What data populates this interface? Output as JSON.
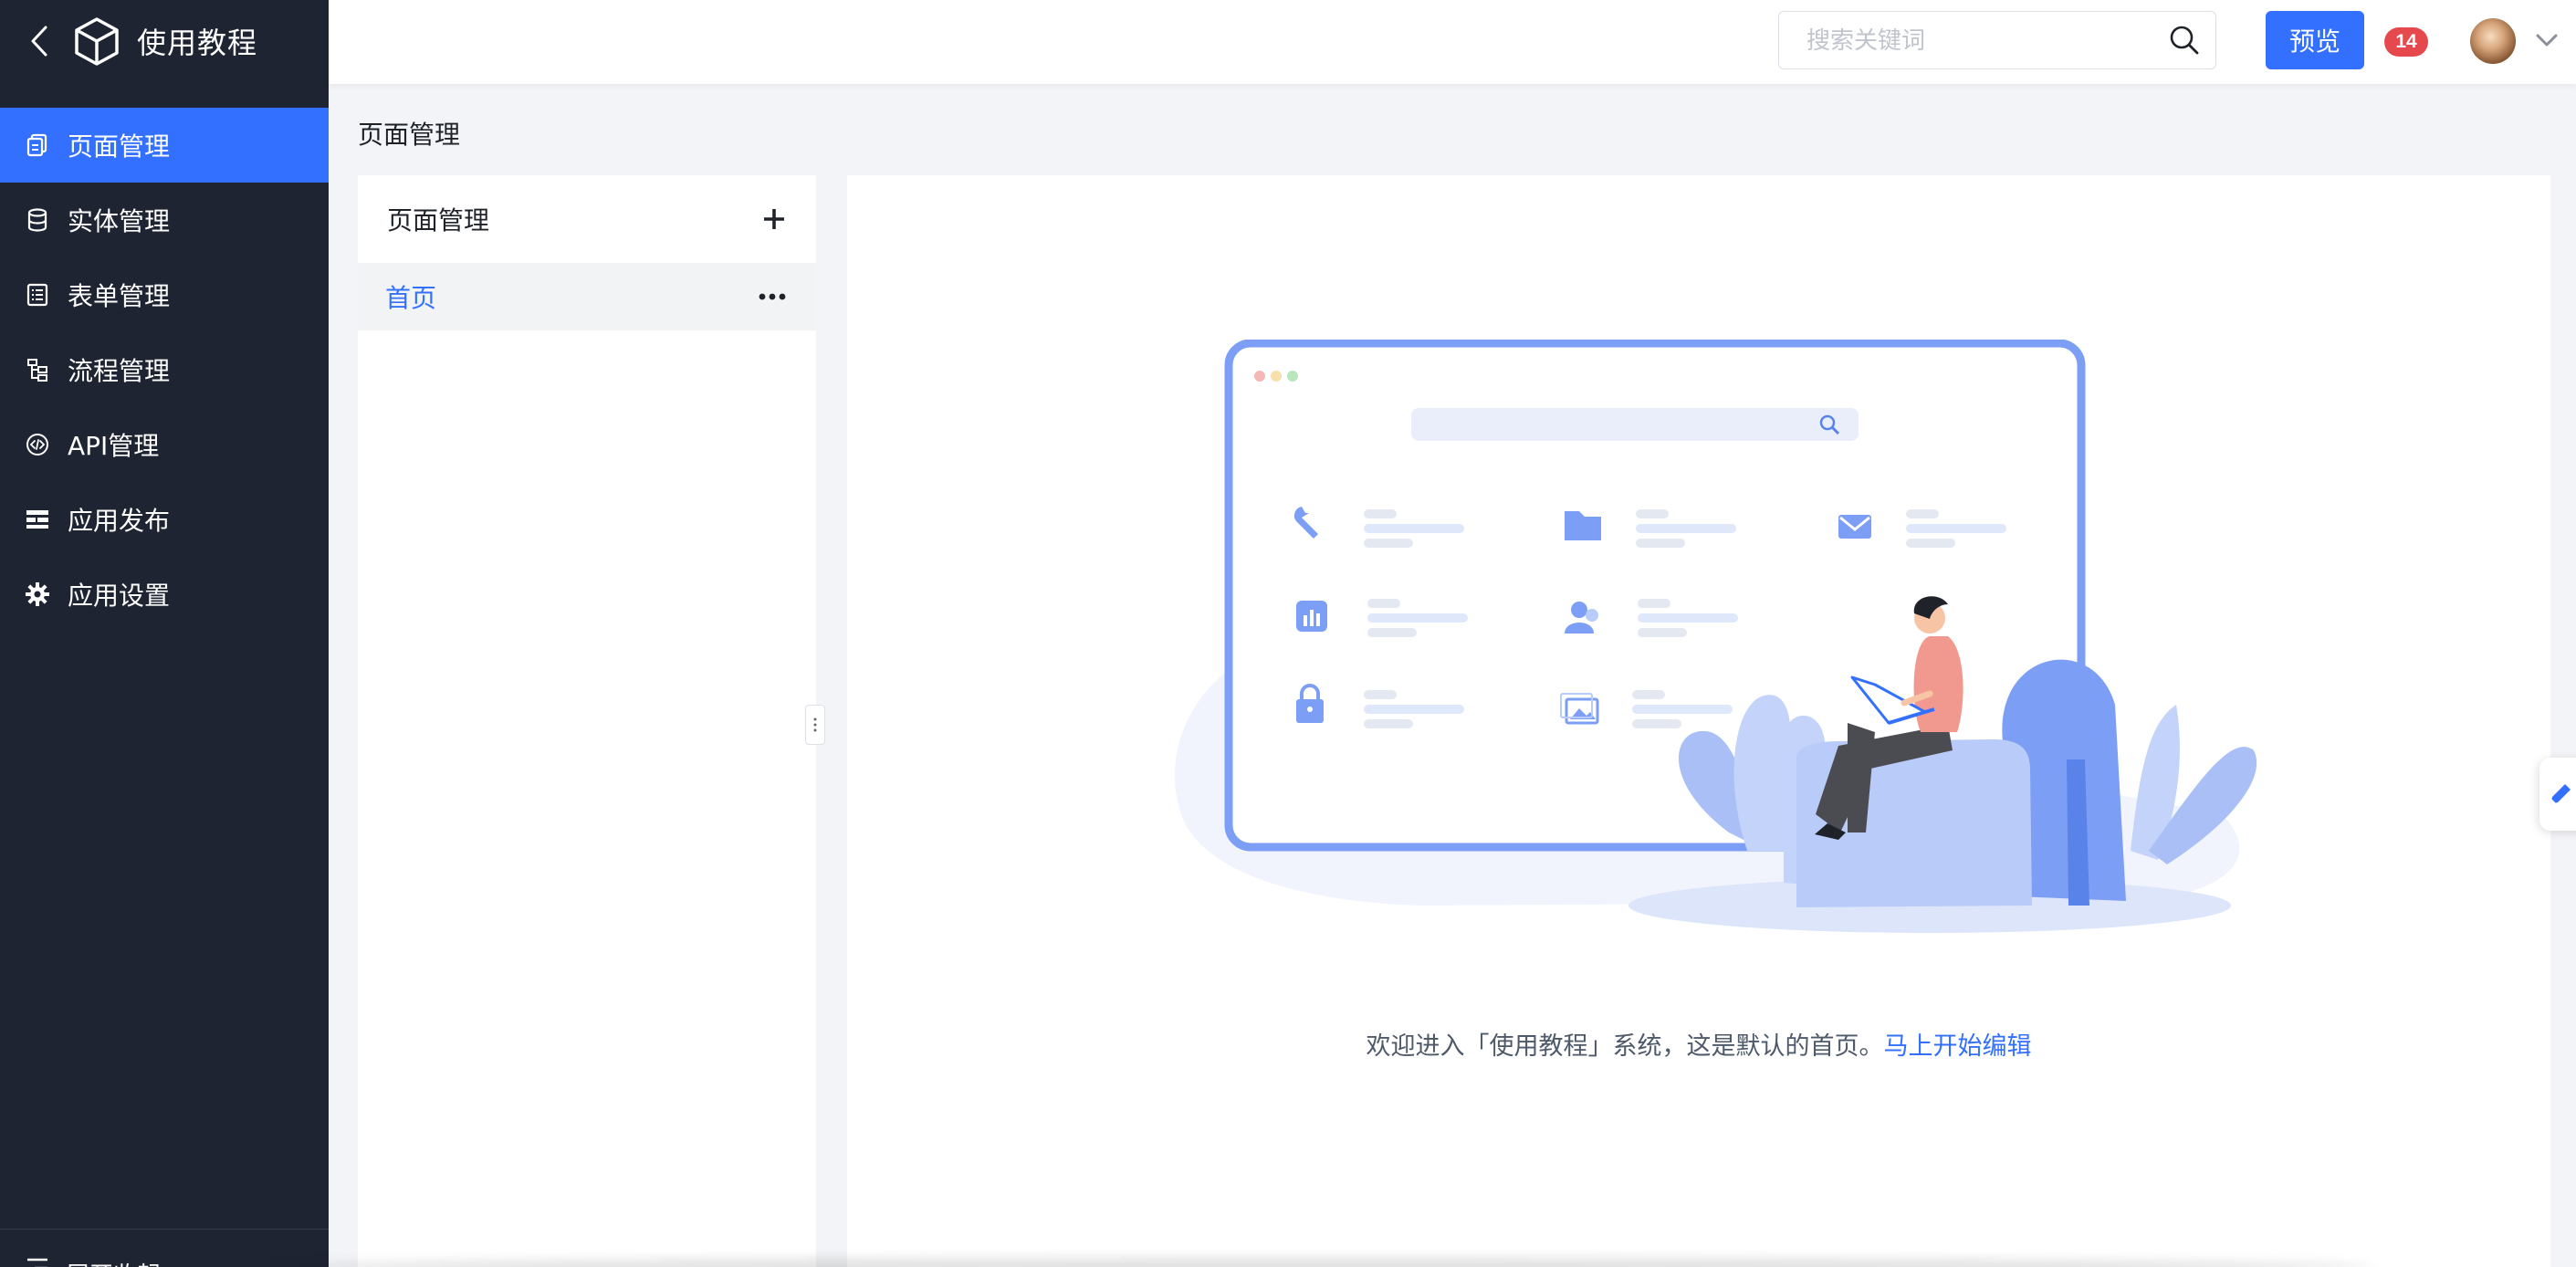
{
  "app": {
    "title": "使用教程"
  },
  "sidebar": {
    "items": [
      {
        "label": "页面管理",
        "icon": "page-icon",
        "active": true
      },
      {
        "label": "实体管理",
        "icon": "database-icon",
        "active": false
      },
      {
        "label": "表单管理",
        "icon": "form-icon",
        "active": false
      },
      {
        "label": "流程管理",
        "icon": "flow-icon",
        "active": false
      },
      {
        "label": "API管理",
        "icon": "api-icon",
        "active": false
      },
      {
        "label": "应用发布",
        "icon": "publish-icon",
        "active": false
      },
      {
        "label": "应用设置",
        "icon": "gear-icon",
        "active": false
      }
    ],
    "footer_label": "展开收起"
  },
  "topbar": {
    "search_placeholder": "搜索关键词",
    "preview_label": "预览",
    "notification_count": "14"
  },
  "breadcrumb": {
    "title": "页面管理"
  },
  "page_panel": {
    "title": "页面管理",
    "pages": [
      {
        "label": "首页"
      }
    ]
  },
  "main": {
    "welcome_text": "欢迎进入「使用教程」系统，这是默认的首页。",
    "edit_link": "马上开始编辑"
  },
  "colors": {
    "sidebar_bg": "#1f2433",
    "accent": "#3370ff",
    "badge": "#e5484d",
    "illustration_blue": "#7c9ef5"
  }
}
